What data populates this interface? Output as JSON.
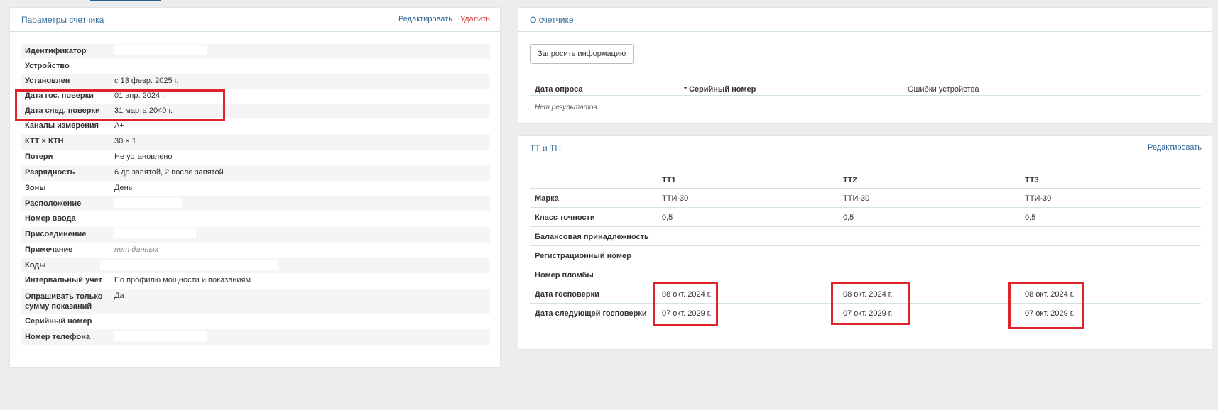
{
  "left_panel": {
    "title": "Параметры счетчика",
    "edit_label": "Редактировать",
    "delete_label": "Удалить",
    "rows": [
      {
        "label": "Идентификатор",
        "value": ""
      },
      {
        "label": "Устройство",
        "value": ""
      },
      {
        "label": "Установлен",
        "value": "с 13 февр. 2025 г."
      },
      {
        "label": "Дата гос. поверки",
        "value": "01 апр. 2024 г."
      },
      {
        "label": "Дата след. поверки",
        "value": "31 марта 2040 г."
      },
      {
        "label": "Каналы измерения",
        "value": "A+"
      },
      {
        "label": "КТТ × КТН",
        "value": "30 × 1"
      },
      {
        "label": "Потери",
        "value": "Не установлено"
      },
      {
        "label": "Разрядность",
        "value": "6 до запятой, 2 после запятой"
      },
      {
        "label": "Зоны",
        "value": "День"
      },
      {
        "label": "Расположение",
        "value": ""
      },
      {
        "label": "Номер ввода",
        "value": ""
      },
      {
        "label": "Присоединение",
        "value": ""
      },
      {
        "label": "Примечание",
        "value": "нет данных"
      },
      {
        "label": "Коды",
        "value": ""
      },
      {
        "label": "Интервальный учет",
        "value": "По профилю мощности и показаниям"
      },
      {
        "label": "Опрашивать только сумму показаний",
        "value": "Да"
      },
      {
        "label": "Серийный номер",
        "value": ""
      },
      {
        "label": "Номер телефона",
        "value": ""
      }
    ]
  },
  "about_panel": {
    "title": "О счетчике",
    "request_button": "Запросить информацию",
    "columns": [
      "Дата опроса",
      "Серийный номер",
      "Ошибки устройства"
    ],
    "no_results": "Нет результатов."
  },
  "tt_panel": {
    "title": "ТТ и ТН",
    "edit_label": "Редактировать",
    "headers": [
      "",
      "ТТ1",
      "ТТ2",
      "ТТ3"
    ],
    "rows": [
      {
        "label": "Марка",
        "v1": "ТТИ-30",
        "v2": "ТТИ-30",
        "v3": "ТТИ-30"
      },
      {
        "label": "Класс точности",
        "v1": "0,5",
        "v2": "0,5",
        "v3": "0,5"
      },
      {
        "label": "Балансовая принадлежность",
        "v1": "",
        "v2": "",
        "v3": ""
      },
      {
        "label": "Регистрационный номер",
        "v1": "",
        "v2": "",
        "v3": ""
      },
      {
        "label": "Номер пломбы",
        "v1": "",
        "v2": "",
        "v3": ""
      },
      {
        "label": "Дата госповерки",
        "v1": "08 окт. 2024 г.",
        "v2": "08 окт. 2024 г.",
        "v3": "08 окт. 2024 г."
      },
      {
        "label": "Дата следующей госповерки",
        "v1": "07 окт. 2029 г.",
        "v2": "07 окт. 2029 г.",
        "v3": "07 окт. 2029 г."
      }
    ]
  },
  "colors": {
    "highlight": "#e0242c",
    "title": "#3b6f98",
    "delete": "#e0393e"
  }
}
